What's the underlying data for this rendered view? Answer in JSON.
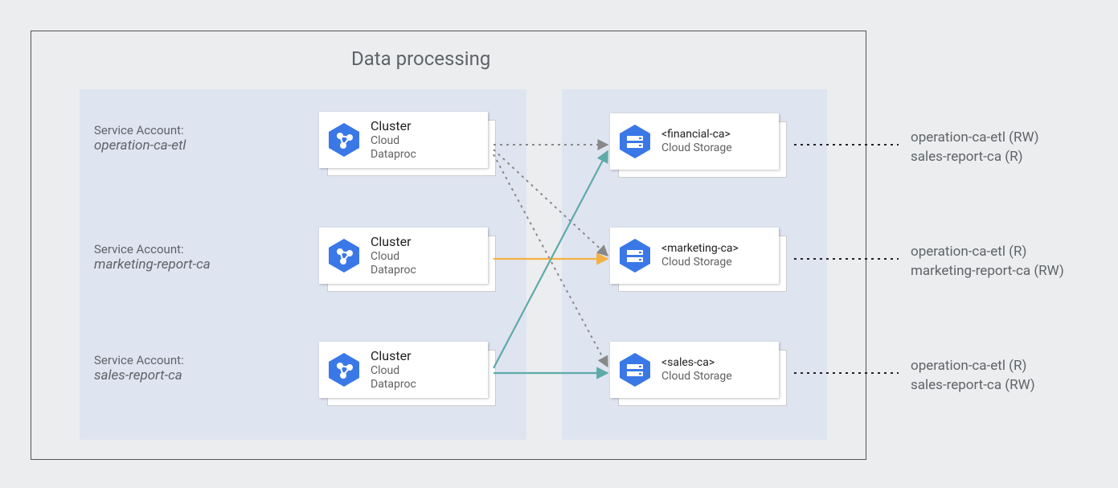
{
  "title": "Data processing",
  "serviceAccountLabel": "Service Account:",
  "clusters": [
    {
      "title": "Cluster",
      "sub1": "Cloud",
      "sub2": "Dataproc",
      "sa": "operation-ca-etl"
    },
    {
      "title": "Cluster",
      "sub1": "Cloud",
      "sub2": "Dataproc",
      "sa": "marketing-report-ca"
    },
    {
      "title": "Cluster",
      "sub1": "Cloud",
      "sub2": "Dataproc",
      "sa": "sales-report-ca"
    }
  ],
  "buckets": [
    {
      "name": "<financial-ca>",
      "sub": "Cloud Storage",
      "perm1": "operation-ca-etl (RW)",
      "perm2": "sales-report-ca (R)"
    },
    {
      "name": "<marketing-ca>",
      "sub": "Cloud Storage",
      "perm1": "operation-ca-etl (R)",
      "perm2": "marketing-report-ca (RW)"
    },
    {
      "name": "<sales-ca>",
      "sub": "Cloud Storage",
      "perm1": "operation-ca-etl (R)",
      "perm2": "sales-report-ca (RW)"
    }
  ]
}
